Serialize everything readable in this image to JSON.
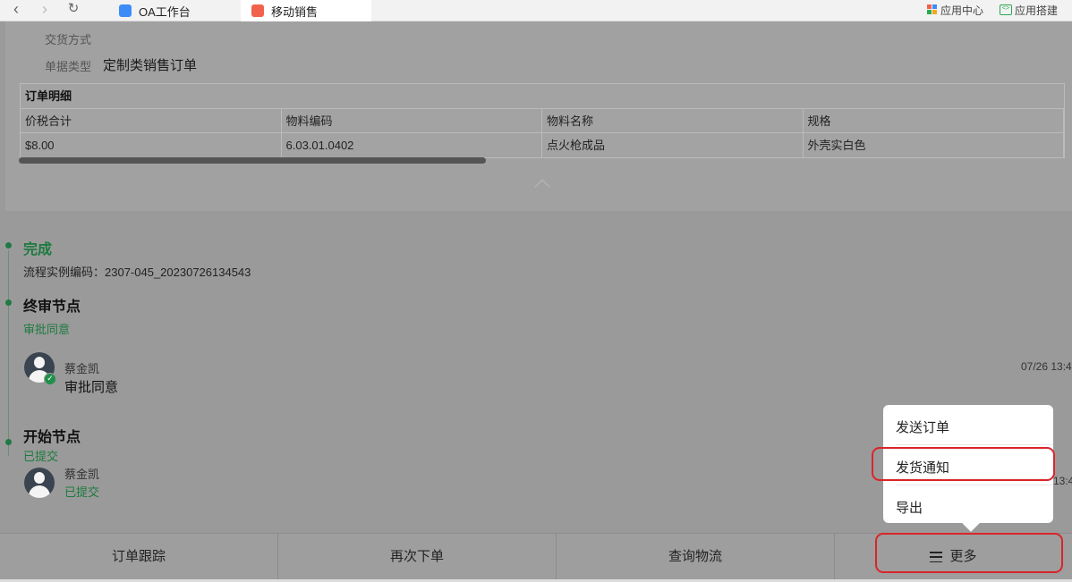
{
  "browser": {
    "tabs": [
      {
        "label": "OA工作台",
        "icon": "grid-app-icon"
      },
      {
        "label": "移动销售",
        "icon": "shopping-bag-icon"
      }
    ],
    "right_links": [
      {
        "label": "应用中心",
        "icon": "app-center-icon"
      },
      {
        "label": "应用搭建",
        "icon": "code-builder-icon"
      }
    ]
  },
  "order": {
    "delivery_label": "交货方式",
    "doc_type_label": "单据类型",
    "doc_type_value": "定制类销售订单",
    "detail_title": "订单明细",
    "columns": [
      "价税合计",
      "物料编码",
      "物料名称",
      "规格"
    ],
    "rows": [
      [
        "$8.00",
        "6.03.01.0402",
        "点火枪成品",
        "外壳实白色"
      ]
    ]
  },
  "flow": {
    "status": "完成",
    "instance_code": "流程实例编码：2307-045_20230726134543",
    "nodes": [
      {
        "title": "终审节点",
        "result": "审批同意",
        "person": "蔡金凯",
        "comment": "审批同意",
        "time": "07/26 13:4"
      },
      {
        "title": "开始节点",
        "result": "已提交",
        "person": "蔡金凯",
        "comment": "已提交",
        "time": "13:4"
      }
    ]
  },
  "popup_menu": {
    "items": [
      "发送订单",
      "发货通知",
      "导出"
    ],
    "highlighted": "发货通知"
  },
  "actions": {
    "track": "订单跟踪",
    "reorder": "再次下单",
    "logistics": "查询物流",
    "more": "更多"
  },
  "colors": {
    "accent_green": "#1c7a3e",
    "highlight_red": "#d9252a",
    "overlay_gray": "#9a9a9a"
  }
}
